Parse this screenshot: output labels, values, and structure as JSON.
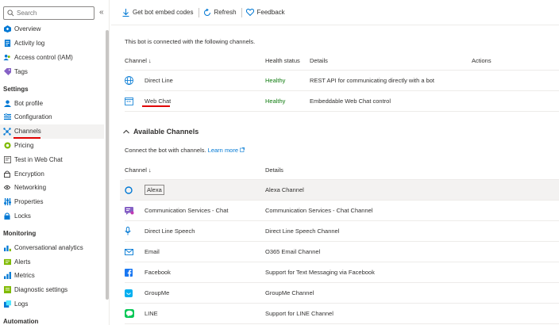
{
  "sidebar": {
    "search_placeholder": "Search",
    "collapse": "«",
    "groups": [
      {
        "items": [
          "Overview",
          "Activity log",
          "Access control (IAM)",
          "Tags"
        ]
      }
    ],
    "settings_header": "Settings",
    "settings_items": [
      "Bot profile",
      "Configuration",
      "Channels",
      "Pricing",
      "Test in Web Chat",
      "Encryption",
      "Networking",
      "Properties",
      "Locks"
    ],
    "monitoring_header": "Monitoring",
    "monitoring_items": [
      "Conversational analytics",
      "Alerts",
      "Metrics",
      "Diagnostic settings",
      "Logs"
    ],
    "automation_header": "Automation"
  },
  "toolbar": {
    "embed": "Get bot embed codes",
    "refresh": "Refresh",
    "feedback": "Feedback"
  },
  "connected": {
    "intro": "This bot is connected with the following channels.",
    "headers": {
      "channel": "Channel ↓",
      "health": "Health status",
      "details": "Details",
      "actions": "Actions"
    },
    "rows": [
      {
        "name": "Direct Line",
        "health": "Healthy",
        "details": "REST API for communicating directly with a bot"
      },
      {
        "name": "Web Chat",
        "health": "Healthy",
        "details": "Embeddable Web Chat control"
      }
    ]
  },
  "available": {
    "title": "Available Channels",
    "desc": "Connect the bot with channels.",
    "learn_more": "Learn more",
    "headers": {
      "channel": "Channel ↓",
      "details": "Details"
    },
    "rows": [
      {
        "name": "Alexa",
        "details": "Alexa Channel"
      },
      {
        "name": "Communication Services - Chat",
        "details": "Communication Services - Chat Channel"
      },
      {
        "name": "Direct Line Speech",
        "details": "Direct Line Speech Channel"
      },
      {
        "name": "Email",
        "details": "O365 Email Channel"
      },
      {
        "name": "Facebook",
        "details": "Support for Text Messaging via Facebook"
      },
      {
        "name": "GroupMe",
        "details": "GroupMe Channel"
      },
      {
        "name": "LINE",
        "details": "Support for LINE Channel"
      }
    ]
  },
  "colors": {
    "accent": "#0078d4",
    "healthy": "#107c10",
    "highlight": "#e00000"
  }
}
